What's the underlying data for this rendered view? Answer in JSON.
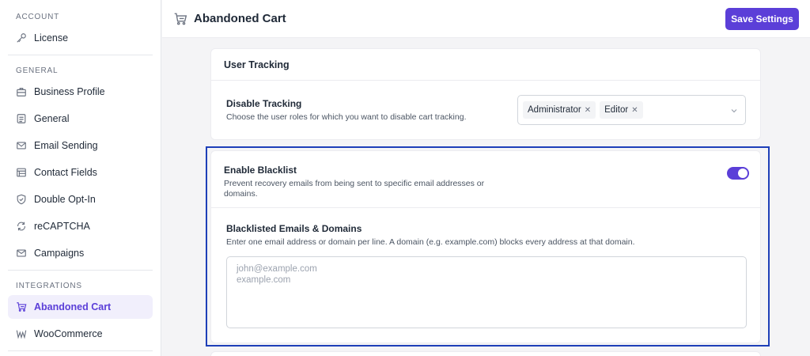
{
  "sidebar": {
    "sections": [
      {
        "heading": "ACCOUNT",
        "items": [
          {
            "label": "License",
            "icon": "key-icon"
          }
        ]
      },
      {
        "heading": "GENERAL",
        "items": [
          {
            "label": "Business Profile",
            "icon": "briefcase-icon"
          },
          {
            "label": "General",
            "icon": "document-icon"
          },
          {
            "label": "Email Sending",
            "icon": "envelope-icon"
          },
          {
            "label": "Contact Fields",
            "icon": "table-icon"
          },
          {
            "label": "Double Opt-In",
            "icon": "shield-check-icon"
          },
          {
            "label": "reCAPTCHA",
            "icon": "recaptcha-icon"
          },
          {
            "label": "Campaigns",
            "icon": "mail-icon"
          }
        ]
      },
      {
        "heading": "INTEGRATIONS",
        "items": [
          {
            "label": "Abandoned Cart",
            "icon": "cart-icon",
            "active": true
          },
          {
            "label": "WooCommerce",
            "icon": "woocommerce-icon"
          }
        ]
      }
    ]
  },
  "header": {
    "title": "Abandoned Cart",
    "save_label": "Save Settings"
  },
  "user_tracking": {
    "title": "User Tracking",
    "disable_label": "Disable Tracking",
    "disable_desc": "Choose the user roles for which you want to disable cart tracking.",
    "roles": [
      "Administrator",
      "Editor"
    ]
  },
  "blacklist": {
    "enable_label": "Enable Blacklist",
    "enable_desc_line1": "Prevent recovery emails from being sent to specific email addresses or",
    "enable_desc_line2": "domains.",
    "enabled": true,
    "emails_label": "Blacklisted Emails & Domains",
    "emails_desc": "Enter one email address or domain per line. A domain (e.g. example.com) blocks every address at that domain.",
    "placeholder": "john@example.com\nexample.com"
  },
  "colors": {
    "accent": "#5b3fd8",
    "highlight": "#1e3fb8"
  }
}
